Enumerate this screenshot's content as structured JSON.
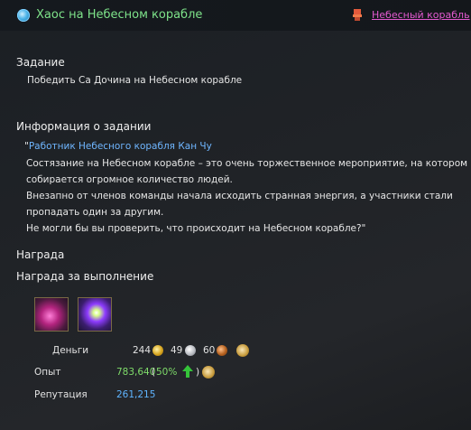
{
  "header": {
    "quest_title": "Хаос на Небесном корабле",
    "location_link": "Небесный корабль"
  },
  "task": {
    "heading": "Задание",
    "text": "Победить Са Дочина на Небесном корабле"
  },
  "info": {
    "heading": "Информация о задании",
    "open_quote": "\"",
    "speaker": "Работник Небесного корабля Кан Чу",
    "lines": [
      "Состязание на Небесном корабле – это очень торжественное мероприятие, на котором",
      "собирается огромное количество людей.",
      "Внезапно от членов команды  начала исходить странная энергия, а участники стали",
      "пропадать один за другим.",
      "Не могли бы вы проверить, что происходит на Небесном корабле?\""
    ]
  },
  "reward": {
    "heading": "Награда",
    "completion_heading": "Награда за выполнение",
    "money_label": "Деньги",
    "gold": "244",
    "silver": "49",
    "copper": "60",
    "exp_label": "Опыт",
    "exp_value": "783,640",
    "exp_open_paren": "(",
    "exp_percent": "50%",
    "exp_close_paren": ")",
    "rep_label": "Репутация",
    "rep_value": "261,215"
  },
  "colors": {
    "title_green": "#7ee38a",
    "link_magenta": "#e35ad0",
    "speaker_blue": "#6fb6ff",
    "exp_green": "#7fdc6a",
    "rep_blue": "#5fb4ff"
  },
  "icons": {
    "quest": "quest-globe-icon",
    "location": "map-pin-icon",
    "gold": "gold-coin-icon",
    "silver": "silver-coin-icon",
    "copper": "copper-coin-icon",
    "bonus": "bonus-bag-icon",
    "exp_up": "green-up-arrow-icon"
  }
}
